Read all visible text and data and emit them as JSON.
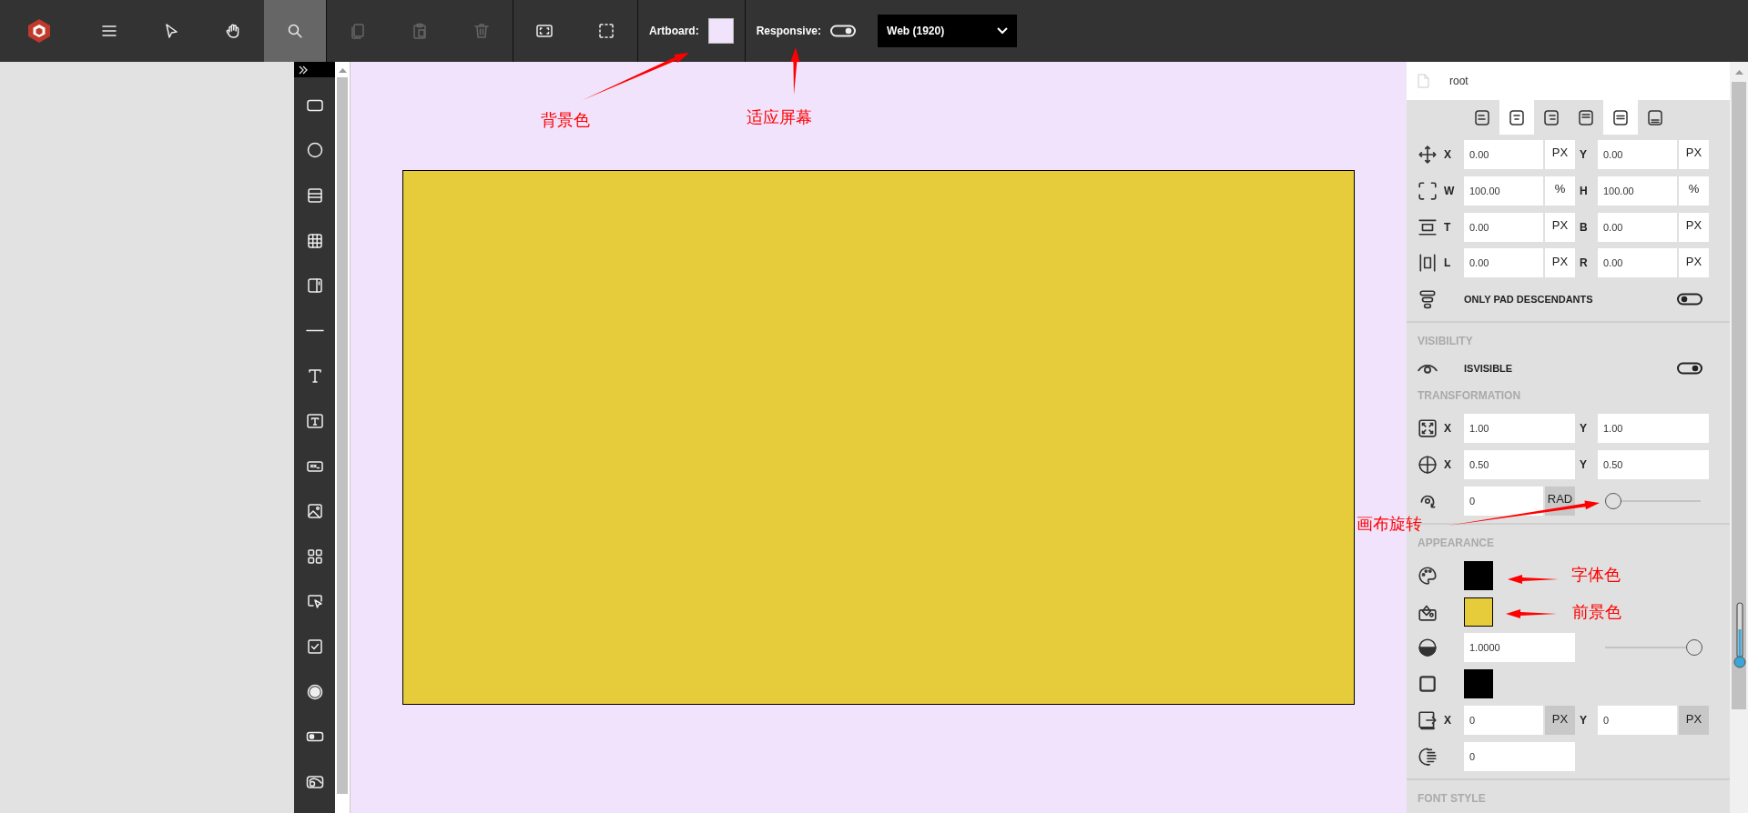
{
  "toolbar": {
    "groups": [
      [
        {
          "kind": "menu",
          "selected": false,
          "disabled": false
        },
        {
          "kind": "pointer",
          "selected": false,
          "disabled": false
        },
        {
          "kind": "hand",
          "selected": false,
          "disabled": false
        },
        {
          "kind": "search",
          "selected": true,
          "disabled": false
        }
      ],
      [
        {
          "kind": "copy",
          "selected": false,
          "disabled": true
        },
        {
          "kind": "paste",
          "selected": false,
          "disabled": true
        },
        {
          "kind": "delete",
          "selected": false,
          "disabled": true
        }
      ],
      [
        {
          "kind": "fit",
          "selected": false,
          "disabled": false
        },
        {
          "kind": "select-area",
          "selected": false,
          "disabled": false
        }
      ]
    ],
    "artboard": {
      "label": "Artboard:",
      "color": "#f0e3fb"
    },
    "responsive": {
      "label": "Responsive:",
      "on": true
    },
    "device": {
      "value": "Web (1920)"
    }
  },
  "tools": [
    {
      "kind": "rectangle"
    },
    {
      "kind": "circle"
    },
    {
      "kind": "stack"
    },
    {
      "kind": "grid"
    },
    {
      "kind": "panel"
    },
    {
      "kind": "line"
    },
    {
      "kind": "text"
    },
    {
      "kind": "text-box"
    },
    {
      "kind": "input"
    },
    {
      "kind": "image"
    },
    {
      "kind": "apps"
    },
    {
      "kind": "cursor-box"
    },
    {
      "kind": "checkbox"
    },
    {
      "kind": "radio"
    },
    {
      "kind": "toggle"
    },
    {
      "kind": "image-button"
    }
  ],
  "canvas": {
    "artboard": {
      "color": "#e6cc3a"
    }
  },
  "panel": {
    "node": "root",
    "align_buttons": [
      {
        "kind": "left",
        "selected": false
      },
      {
        "kind": "center",
        "selected": true
      },
      {
        "kind": "right",
        "selected": false
      },
      {
        "kind": "top",
        "selected": false
      },
      {
        "kind": "middle",
        "selected": true
      },
      {
        "kind": "bottom",
        "selected": false
      }
    ],
    "rows": [
      {
        "kind": "position",
        "fields": [
          {
            "label": "X",
            "value": "0.00",
            "unit": {
              "text": "PX",
              "disabled": false
            }
          },
          {
            "label": "Y",
            "value": "0.00",
            "unit": {
              "text": "PX",
              "disabled": false
            }
          }
        ]
      },
      {
        "kind": "size",
        "fields": [
          {
            "label": "W",
            "value": "100.00",
            "unit": {
              "text": "%",
              "disabled": false
            }
          },
          {
            "label": "H",
            "value": "100.00",
            "unit": {
              "text": "%",
              "disabled": false
            }
          }
        ]
      },
      {
        "kind": "padding-vertical",
        "fields": [
          {
            "label": "T",
            "value": "0.00",
            "unit": {
              "text": "PX",
              "disabled": false
            }
          },
          {
            "label": "B",
            "value": "0.00",
            "unit": {
              "text": "PX",
              "disabled": false
            }
          }
        ]
      },
      {
        "kind": "padding-horizontal",
        "fields": [
          {
            "label": "L",
            "value": "0.00",
            "unit": {
              "text": "PX",
              "disabled": false
            }
          },
          {
            "label": "R",
            "value": "0.00",
            "unit": {
              "text": "PX",
              "disabled": false
            }
          }
        ]
      },
      {
        "kind": "pad-toggle",
        "label": "ONLY PAD DESCENDANTS",
        "on": false
      },
      {
        "kind": "divider"
      },
      {
        "kind": "heading",
        "label": "VISIBILITY"
      },
      {
        "kind": "visible-toggle",
        "label": "ISVISIBLE",
        "on": true
      },
      {
        "kind": "heading",
        "label": "TRANSFORMATION"
      },
      {
        "kind": "scale",
        "fields": [
          {
            "label": "X",
            "value": "1.00"
          },
          {
            "label": "Y",
            "value": "1.00"
          }
        ]
      },
      {
        "kind": "pivot",
        "fields": [
          {
            "label": "X",
            "value": "0.50"
          },
          {
            "label": "Y",
            "value": "0.50"
          }
        ]
      },
      {
        "kind": "rotation",
        "value": "0",
        "unit": {
          "text": "RAD",
          "disabled": true
        },
        "level": 0
      },
      {
        "kind": "divider"
      },
      {
        "kind": "heading",
        "label": "APPEARANCE"
      },
      {
        "kind": "font-color",
        "color": "#000000"
      },
      {
        "kind": "fill-color",
        "color": "#e6cc3a"
      },
      {
        "kind": "opacity",
        "value": "1.0000",
        "level": 1
      },
      {
        "kind": "border-color",
        "color": "#000000"
      },
      {
        "kind": "shadow",
        "fields": [
          {
            "label": "X",
            "value": "0",
            "unit": {
              "text": "PX",
              "disabled": true
            }
          },
          {
            "label": "Y",
            "value": "0",
            "unit": {
              "text": "PX",
              "disabled": true
            }
          }
        ]
      },
      {
        "kind": "blur",
        "value": "0"
      },
      {
        "kind": "divider"
      },
      {
        "kind": "heading",
        "label": "FONT STYLE"
      }
    ]
  },
  "annotations": [
    {
      "text": "背景色"
    },
    {
      "text": "适应屏幕"
    },
    {
      "text": "画布旋转"
    },
    {
      "text": "字体色"
    },
    {
      "text": "前景色"
    }
  ]
}
